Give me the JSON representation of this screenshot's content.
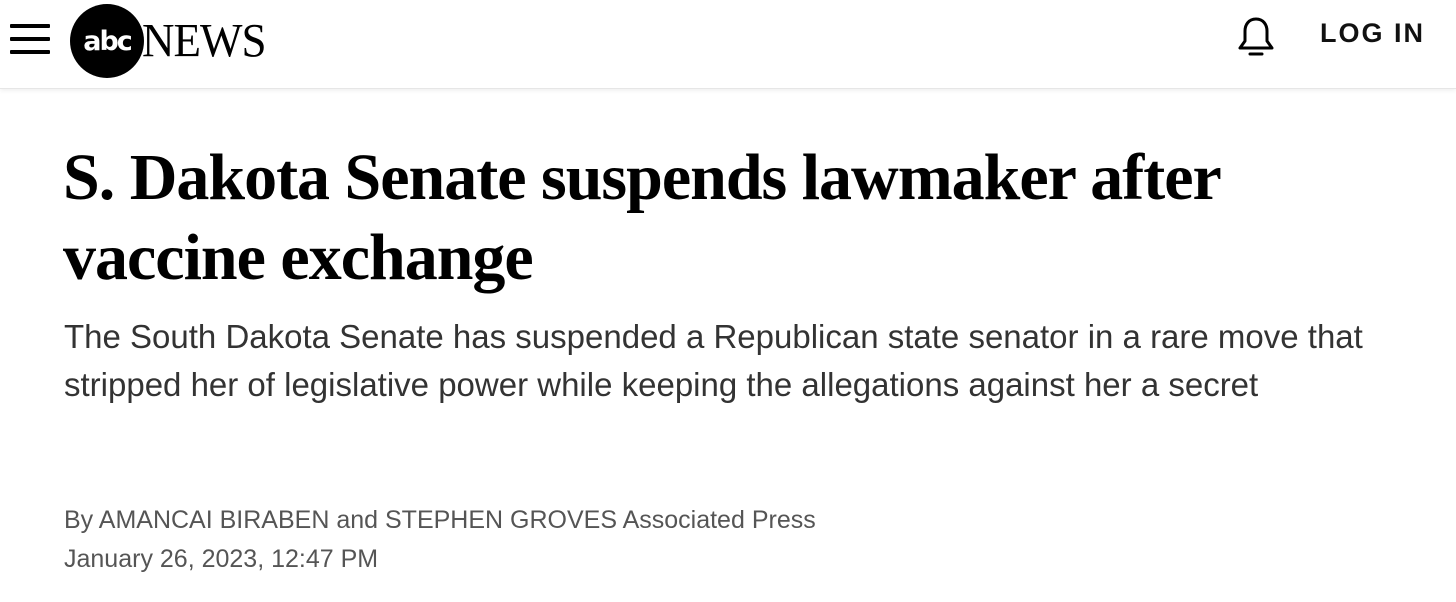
{
  "header": {
    "logo_mark": "abc",
    "logo_word": "NEWS",
    "login_label": "LOG IN"
  },
  "article": {
    "headline_line1": "S. Dakota Senate suspends lawmaker after",
    "headline_line2": "vaccine exchange",
    "subheadline": "The South Dakota Senate has suspended a Republican state senator in a rare move that stripped her of legislative power while keeping the allegations against her a secret",
    "byline": {
      "prefix": "By",
      "author1": "AMANCAI BIRABEN",
      "conjunction": "and",
      "author2": "STEPHEN GROVES",
      "source": "Associated Press"
    },
    "date": "January 26, 2023, 12:47 PM"
  },
  "icons": {
    "menu": "hamburger-menu-icon",
    "notifications": "bell-icon"
  },
  "colors": {
    "brand": "#000000",
    "headline": "#000000",
    "subheadline": "#333333",
    "meta": "#555555"
  }
}
